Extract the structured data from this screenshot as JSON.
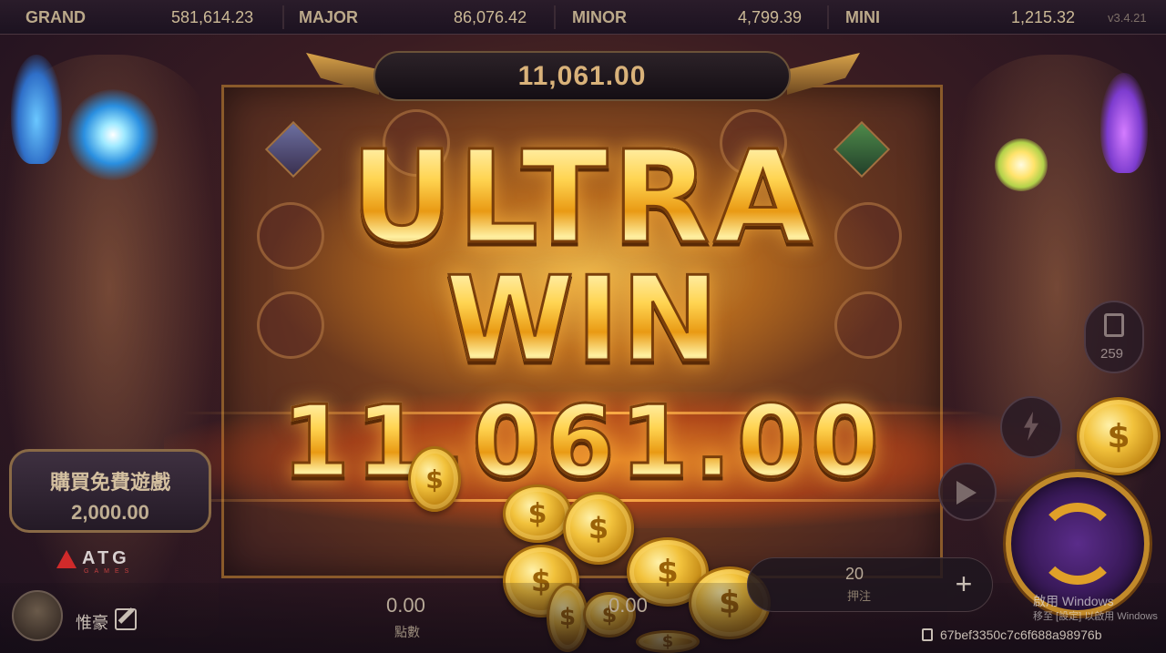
{
  "jackpots": [
    {
      "label": "GRAND",
      "value": "581,614.23"
    },
    {
      "label": "MAJOR",
      "value": "86,076.42"
    },
    {
      "label": "MINOR",
      "value": "4,799.39"
    },
    {
      "label": "MINI",
      "value": "1,215.32"
    }
  ],
  "version": "v3.4.21",
  "total_win_display": "11,061.00",
  "overlay": {
    "line1": "ULTRA",
    "line2": "WIN",
    "amount": "11,061.00"
  },
  "buy_feature": {
    "title": "購買免費遊戲",
    "price": "2,000.00"
  },
  "brand": {
    "name": "ATG",
    "sub": "GAMES"
  },
  "player": {
    "name": "惟豪"
  },
  "stats": {
    "points_value": "0.00",
    "points_label": "點數",
    "win_value": "0.00"
  },
  "lines": {
    "value": "20",
    "label": "押注",
    "plus": "+"
  },
  "history_count": "259",
  "coin_symbol": "$",
  "watermark": {
    "title": "啟用 Windows",
    "sub": "移至 [設定] 以啟用 Windows"
  },
  "session_id": "67bef3350c7c6f688a98976b",
  "colors": {
    "gold": "#ffd451",
    "accent_orange": "#ff9a30",
    "spin_purple": "#5a2c8a"
  },
  "icons": [
    "edit-icon",
    "copy-icon",
    "history-icon",
    "turbo-icon",
    "auto-play-icon",
    "spin-icon"
  ]
}
